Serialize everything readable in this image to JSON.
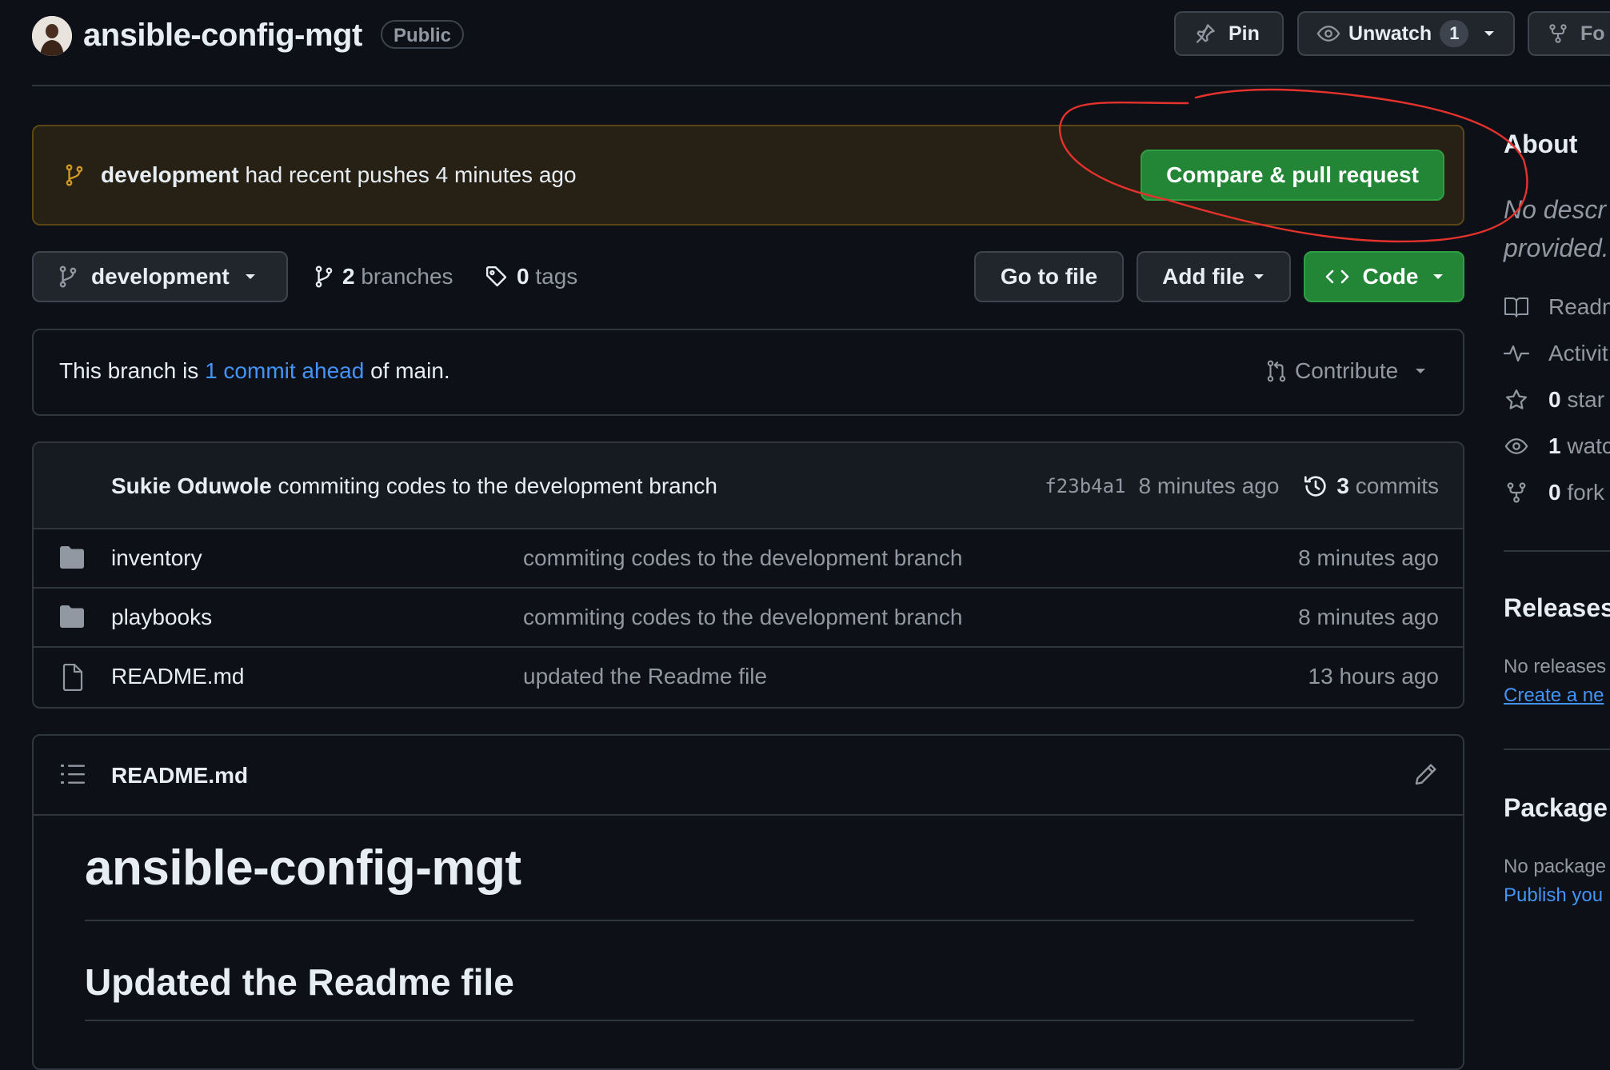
{
  "repo": {
    "name": "ansible-config-mgt",
    "visibility": "Public"
  },
  "header": {
    "pin_label": "Pin",
    "unwatch_label": "Unwatch",
    "watch_count": "1",
    "fork_label": "Fo"
  },
  "banner": {
    "branch": "development",
    "text": " had recent pushes 4 minutes ago",
    "compare_label": "Compare & pull request"
  },
  "toolbar": {
    "branch": "development",
    "branches_count": "2",
    "branches_label": "branches",
    "tags_count": "0",
    "tags_label": "tags",
    "go_to_file": "Go to file",
    "add_file": "Add file",
    "code": "Code"
  },
  "ahead": {
    "prefix": "This branch is ",
    "link": "1 commit ahead",
    "suffix": " of main.",
    "contribute": "Contribute"
  },
  "latest_commit": {
    "author": "Sukie Oduwole",
    "message": " commiting codes to the development branch",
    "sha": "f23b4a1",
    "time": "8 minutes ago",
    "commits_count": "3",
    "commits_label": "commits"
  },
  "files": [
    {
      "name": "inventory",
      "type": "folder",
      "message": "commiting codes to the development branch",
      "time": "8 minutes ago"
    },
    {
      "name": "playbooks",
      "type": "folder",
      "message": "commiting codes to the development branch",
      "time": "8 minutes ago"
    },
    {
      "name": "README.md",
      "type": "file",
      "message": "updated the Readme file",
      "time": "13 hours ago"
    }
  ],
  "readme": {
    "filename": "README.md",
    "h1": "ansible-config-mgt",
    "h2": "Updated the Readme file"
  },
  "sidebar": {
    "about_title": "About",
    "desc_line1": "No descr",
    "desc_line2": "provided.",
    "readme": "Readm",
    "activity": "Activit",
    "stars_count": "0",
    "stars_label": "star",
    "watching_count": "1",
    "watching_label": "watc",
    "forks_count": "0",
    "forks_label": "fork",
    "releases_title": "Releases",
    "releases_text": "No releases",
    "releases_link": "Create a ne",
    "packages_title": "Package",
    "packages_text": "No package",
    "packages_link": "Publish you"
  },
  "colors": {
    "background": "#0d1117",
    "primary_green": "#238636",
    "link_blue": "#4493f8",
    "banner_bg": "#272115",
    "annotation_red": "#e5322d"
  }
}
